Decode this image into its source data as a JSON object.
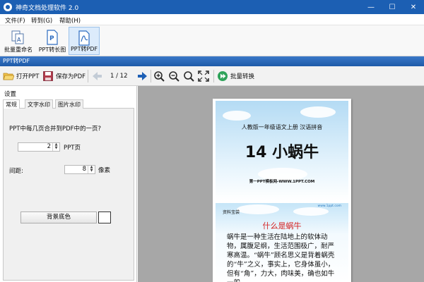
{
  "window": {
    "title": "神奇文档处理软件 2.0",
    "minimize": "—",
    "maximize": "☐",
    "close": "✕"
  },
  "menu": {
    "items": [
      "文件(F)",
      "转到(G)",
      "帮助(H)"
    ]
  },
  "ribbon": {
    "buttons": [
      "批量重命名",
      "PPT转长图",
      "PPT转PDF"
    ]
  },
  "panel": {
    "header": "PPT转PDF"
  },
  "toolbar": {
    "open": "打开PPT",
    "save": "保存为PDF",
    "page_indicator": "1 / 12",
    "batch": "批量转换"
  },
  "settings": {
    "title": "设置",
    "tabs": [
      "常规",
      "文字水印",
      "图片水印"
    ],
    "question": "PPT中每几页合并到PDF中的一页?",
    "pages_value": "2",
    "pages_unit": "PPT页",
    "spacing_label": "间距:",
    "spacing_value": "8",
    "spacing_unit": "像素",
    "bg_button": "背景底色",
    "bg_color": "#ffffff"
  },
  "slide1": {
    "subtitle": "人教版一年级语文上册   汉语拼音",
    "title": "14 小蜗牛",
    "site": "第一PPT模板网-WWW.1PPT.COM"
  },
  "slide2": {
    "tag": "资料宝袋",
    "mark": "www.1ppt.com",
    "heading": "什么是蜗牛",
    "body": "蜗牛是一种生活在陆地上的软体动物，属腹足纲，生活范围极广，耐严寒高温。“蜗牛”顾名思义是背着蜗壳的“牛”之义，事实上，它身体虽小，但有“角”，力大，肉味美，确也如牛一般。"
  }
}
